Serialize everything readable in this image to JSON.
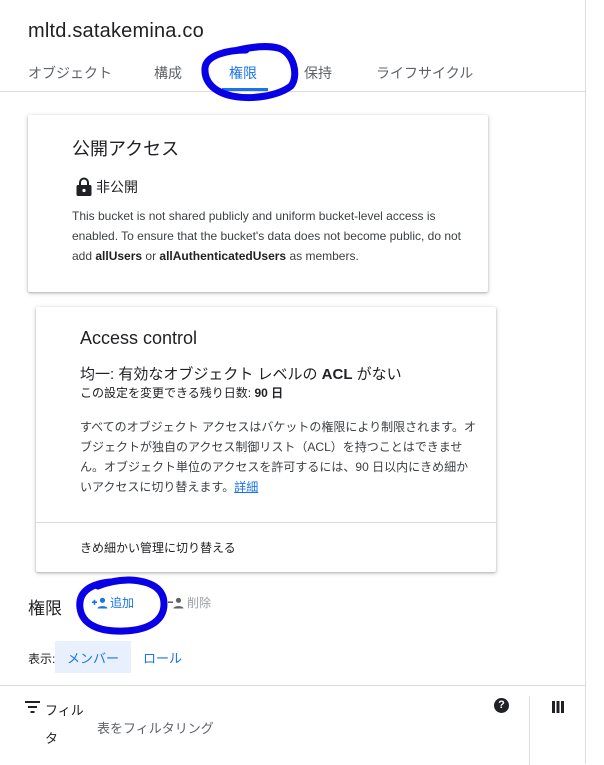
{
  "header": {
    "bucket_name": "mltd.satakemina.co"
  },
  "tabs": [
    "オブジェクト",
    "構成",
    "権限",
    "保持",
    "ライフサイクル"
  ],
  "public_access": {
    "title": "公開アクセス",
    "status": "非公開",
    "desc_1": "This bucket is not shared publicly and uniform bucket-level access is enabled. To ensure that the bucket's data does not become public, do not add ",
    "bold_1": "allUsers",
    "desc_2": " or ",
    "bold_2": "allAuthenticatedUsers",
    "desc_3": " as members."
  },
  "access_control": {
    "title": "Access control",
    "uniform_prefix": "均一: 有効なオブジェクト レベルの ",
    "uniform_acl": "ACL",
    "uniform_suffix": " がない",
    "remaining_prefix": "この設定を変更できる残り日数: ",
    "remaining_days": "90 日",
    "description": "すべてのオブジェクト アクセスはバケットの権限により制限されます。オブジェクトが独自のアクセス制御リスト（ACL）を持つことはできません。オブジェクト単位のアクセスを許可するには、90 日以内にきめ細かいアクセスに切り替えます。",
    "details_link": "詳細",
    "switch_label": "きめ細かい管理に切り替える"
  },
  "permissions": {
    "title": "権限",
    "add_label": "追加",
    "delete_label": "削除",
    "view_label": "表示:",
    "view_options": [
      "メンバー",
      "ロール"
    ],
    "filter_label": "フィルタ",
    "filter_placeholder": "表をフィルタリング"
  },
  "colors": {
    "accent": "#1a73e8",
    "annotation": "#0a00e6",
    "text": "#202124",
    "disabled": "#9aa0a6"
  },
  "icons": [
    "lock-icon",
    "add-person-icon",
    "remove-person-icon",
    "filter-icon",
    "help-icon",
    "columns-icon"
  ]
}
